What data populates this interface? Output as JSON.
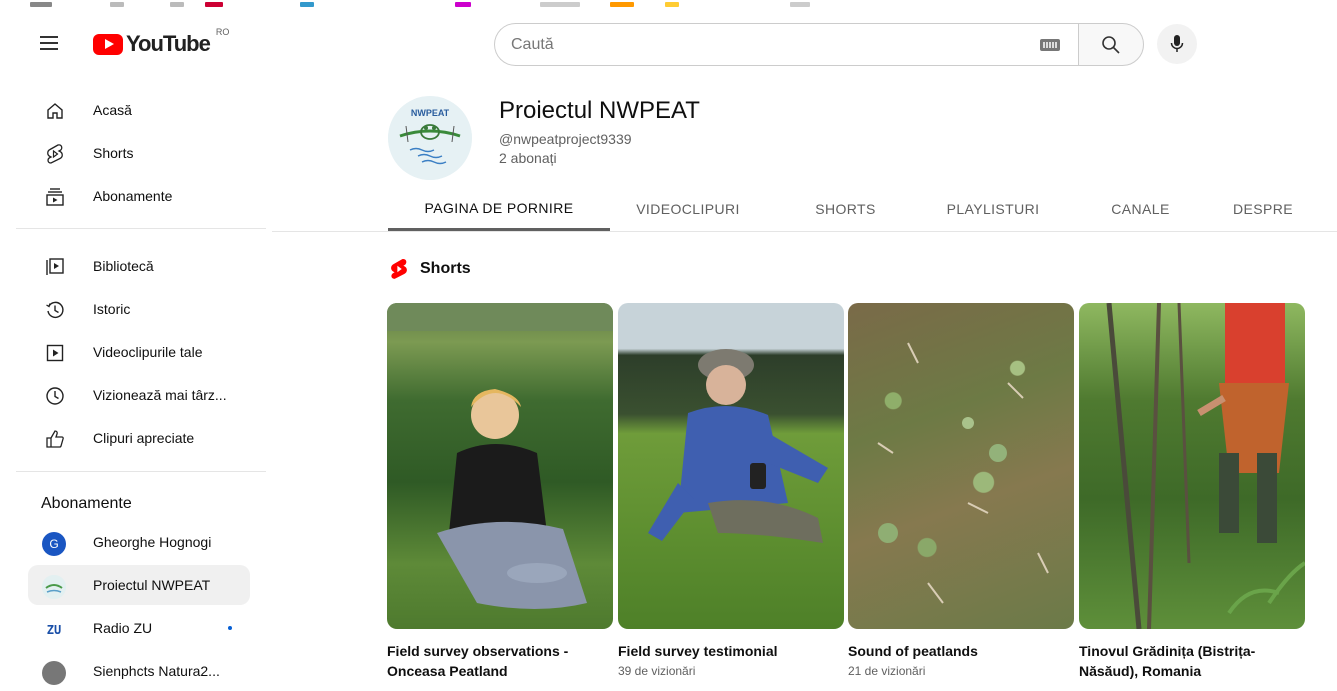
{
  "header": {
    "logo_text": "YouTube",
    "country": "RO",
    "search_placeholder": "Caută"
  },
  "sidebar": {
    "main": [
      {
        "label": "Acasă",
        "icon": "home-icon"
      },
      {
        "label": "Shorts",
        "icon": "shorts-icon"
      },
      {
        "label": "Abonamente",
        "icon": "subscriptions-icon"
      }
    ],
    "library": [
      {
        "label": "Bibliotecă",
        "icon": "library-icon"
      },
      {
        "label": "Istoric",
        "icon": "history-icon"
      },
      {
        "label": "Videoclipurile tale",
        "icon": "your-videos-icon"
      },
      {
        "label": "Vizionează mai târz...",
        "icon": "watch-later-icon"
      },
      {
        "label": "Clipuri apreciate",
        "icon": "liked-icon"
      }
    ],
    "subscriptions_heading": "Abonamente",
    "subscriptions": [
      {
        "label": "Gheorghe Hognogi",
        "avatar_letter": "G",
        "avatar_color": "#1a56c2"
      },
      {
        "label": "Proiectul NWPEAT",
        "active": true
      },
      {
        "label": "Radio ZU",
        "logo_text": "ZU",
        "new_content": true
      },
      {
        "label": "Sienphcts Natura2..."
      }
    ]
  },
  "channel": {
    "name": "Proiectul NWPEAT",
    "handle": "@nwpeatproject9339",
    "subscribers": "2 abonați",
    "avatar_text": "NWPEAT"
  },
  "tabs": [
    {
      "label": "PAGINA DE PORNIRE",
      "active": true
    },
    {
      "label": "VIDEOCLIPURI"
    },
    {
      "label": "SHORTS"
    },
    {
      "label": "PLAYLISTURI"
    },
    {
      "label": "CANALE"
    },
    {
      "label": "DESPRE"
    }
  ],
  "shorts_section": {
    "title": "Shorts",
    "items": [
      {
        "title": "Field survey observations - Onceasa Peatland",
        "views": ""
      },
      {
        "title": "Field survey testimonial",
        "views": "39 de vizionări"
      },
      {
        "title": "Sound of peatlands",
        "views": "21 de vizionări"
      },
      {
        "title": "Tinovul Grădinița (Bistrița-Năsăud), Romania",
        "views": ""
      }
    ]
  },
  "colors": {
    "brand_red": "#ff0000",
    "text_secondary": "#606060",
    "active_bg": "#f0f0f0"
  }
}
